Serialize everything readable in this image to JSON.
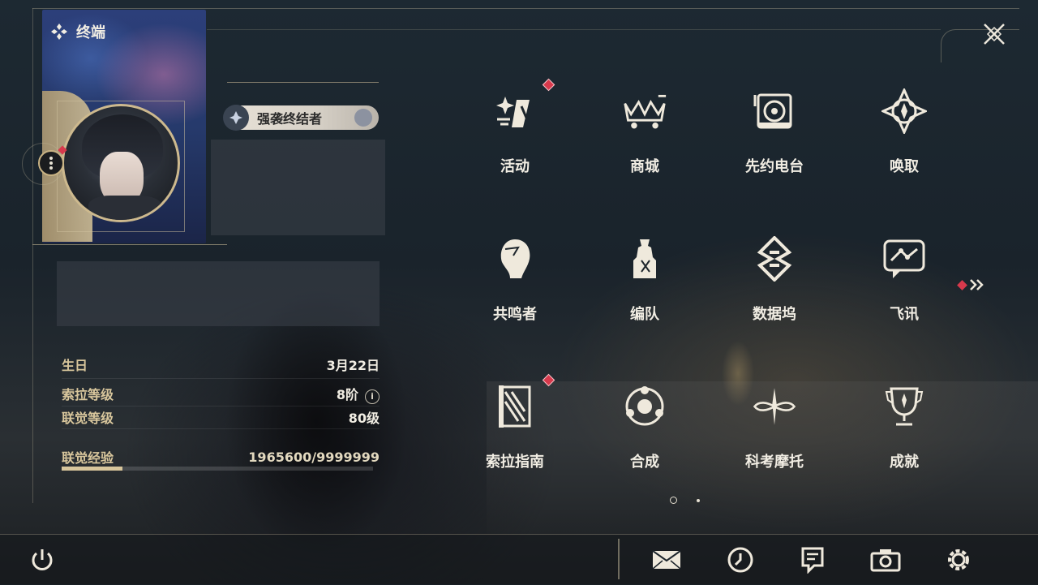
{
  "header": {
    "title": "终端"
  },
  "profile": {
    "title_badge": "强袭终结者",
    "birthday_label": "生日",
    "birthday_value": "3月22日",
    "sola_level_label": "索拉等级",
    "sola_level_value": "8阶",
    "union_level_label": "联觉等级",
    "union_level_value": "80级",
    "union_exp_label": "联觉经验",
    "union_exp_value": "1965600/9999999",
    "union_exp_progress": 0.19656
  },
  "menu": {
    "items": [
      {
        "label": "活动",
        "icon": "activity-icon",
        "badge": true
      },
      {
        "label": "商城",
        "icon": "shop-icon",
        "badge": false
      },
      {
        "label": "先约电台",
        "icon": "radio-icon",
        "badge": false
      },
      {
        "label": "唤取",
        "icon": "convene-icon",
        "badge": false
      },
      {
        "label": "共鸣者",
        "icon": "resonator-icon",
        "badge": false
      },
      {
        "label": "编队",
        "icon": "team-icon",
        "badge": false
      },
      {
        "label": "数据坞",
        "icon": "data-bank-icon",
        "badge": false
      },
      {
        "label": "飞讯",
        "icon": "chat-icon",
        "badge": false
      },
      {
        "label": "索拉指南",
        "icon": "guidebook-icon",
        "badge": true
      },
      {
        "label": "合成",
        "icon": "synthesis-icon",
        "badge": false
      },
      {
        "label": "科考摩托",
        "icon": "motorcycle-icon",
        "badge": false
      },
      {
        "label": "成就",
        "icon": "achievement-icon",
        "badge": false
      }
    ]
  },
  "pager": {
    "current": 1,
    "total": 2
  },
  "bottom_bar": {
    "icons": [
      "power-icon",
      "mail-icon",
      "clock-icon",
      "notice-icon",
      "camera-icon",
      "settings-icon"
    ]
  },
  "colors": {
    "accent_gold": "#d8c69c",
    "badge_red": "#d8394c"
  }
}
